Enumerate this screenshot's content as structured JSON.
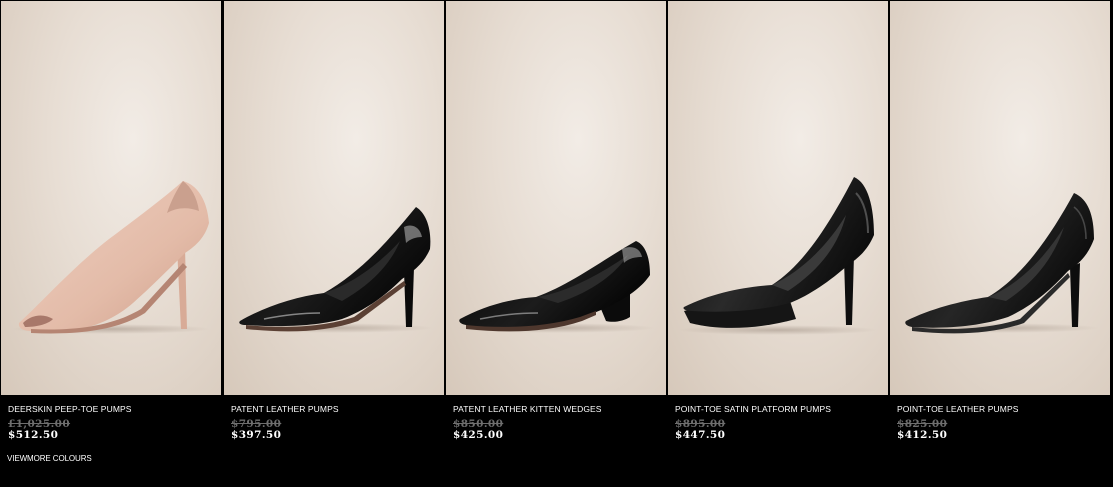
{
  "products": [
    {
      "name": "DEERSKIN PEEP-TOE PUMPS",
      "old_price": "£1,025.00",
      "price": "$512.50",
      "colour": "#e8c3b2",
      "image_alt": "nude deerskin peep-toe pump"
    },
    {
      "name": "PATENT LEATHER PUMPS",
      "old_price": "$795.00",
      "price": "$397.50",
      "colour": "#0b0b0b",
      "image_alt": "black patent leather pump"
    },
    {
      "name": "PATENT LEATHER KITTEN WEDGES",
      "old_price": "$850.00",
      "price": "$425.00",
      "colour": "#0b0b0b",
      "image_alt": "black patent leather kitten wedge"
    },
    {
      "name": "POINT-TOE SATIN PLATFORM PUMPS",
      "old_price": "$895.00",
      "price": "$447.50",
      "colour": "#111111",
      "image_alt": "black satin point-toe platform pump"
    },
    {
      "name": "POINT-TOE LEATHER PUMPS",
      "old_price": "$825.00",
      "price": "$412.50",
      "colour": "#121212",
      "image_alt": "black point-toe leather pump"
    }
  ],
  "view_more_colours": "VIEWMORE COLOURS",
  "colors": {
    "page_background": "#000000",
    "photo_background": "#e7ddd3",
    "text": "#ffffff",
    "old_price_text": "#6e6e6e"
  }
}
